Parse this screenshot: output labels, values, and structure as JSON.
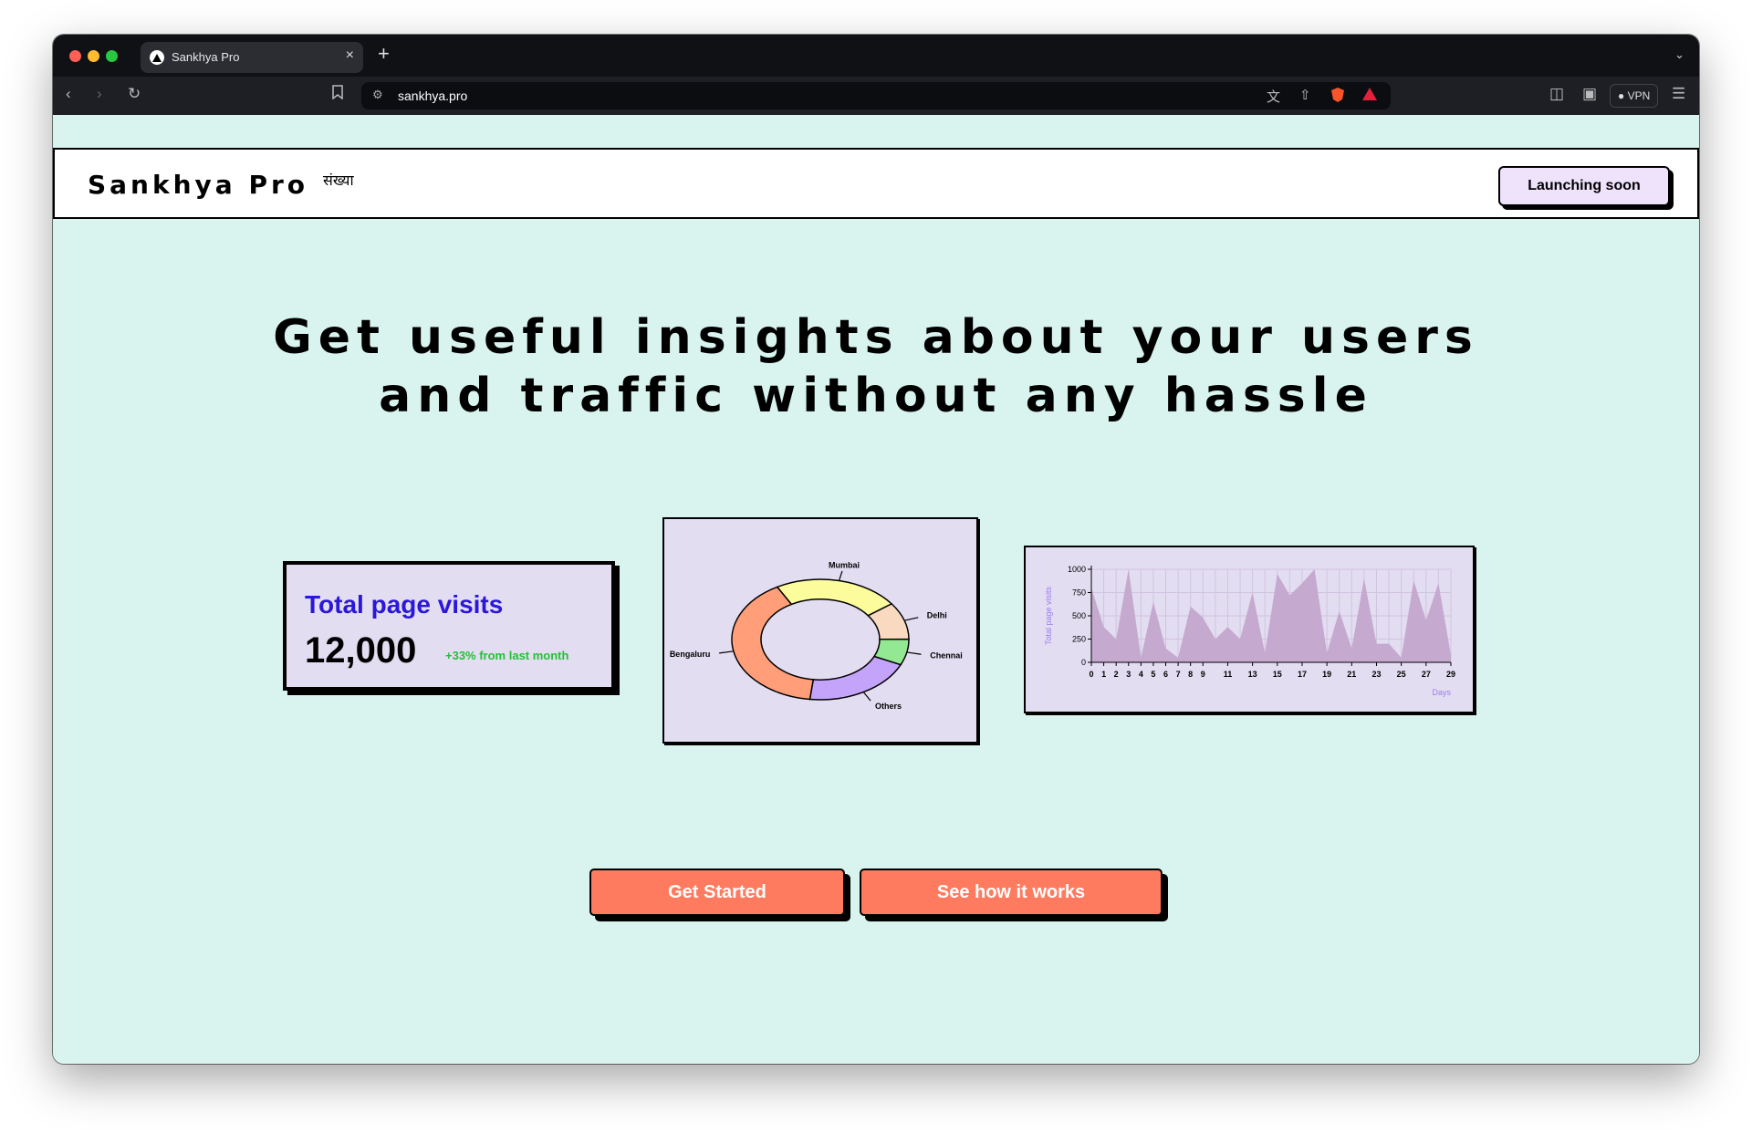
{
  "browser": {
    "tab_title": "Sankhya Pro",
    "url": "sankhya.pro",
    "vpn_label": "VPN",
    "icons": [
      "close-icon",
      "plus-icon",
      "chevron-down-icon",
      "back-icon",
      "forward-icon",
      "reload-icon",
      "bookmark-icon",
      "site-settings-icon",
      "translate-icon",
      "share-icon",
      "brave-shield-icon",
      "brave-rewards-icon",
      "sidebar-icon",
      "wallet-icon",
      "menu-icon"
    ]
  },
  "nav": {
    "brand": "Sankhya Pro",
    "brand_sub": "संख्या",
    "launch_button": "Launching soon"
  },
  "hero": {
    "line1": "Get useful insights about your users",
    "line2": "and traffic without any hassle"
  },
  "stats": {
    "title": "Total page visits",
    "value": "12,000",
    "change": "+33% from last month"
  },
  "buttons": {
    "get_started": "Get Started",
    "how_it_works": "See how it works"
  },
  "chart_data": [
    {
      "type": "pie",
      "donut": true,
      "labels": [
        "Mumbai",
        "Delhi",
        "Chennai",
        "Others",
        "Bengaluru"
      ],
      "values": [
        23,
        10,
        7,
        20,
        40
      ],
      "colors": [
        "#fcfc9d",
        "#f9dac1",
        "#93e893",
        "#c4a4fa",
        "#ff9e78"
      ]
    },
    {
      "type": "area",
      "xlabel": "Days",
      "ylabel": "Total page visits",
      "ylim": [
        0,
        1000
      ],
      "yticks": [
        0,
        250,
        500,
        750,
        1000
      ],
      "xticks": [
        0,
        1,
        2,
        3,
        4,
        5,
        6,
        7,
        8,
        9,
        11,
        13,
        15,
        17,
        19,
        21,
        23,
        25,
        27,
        29
      ],
      "x": [
        0,
        1,
        2,
        3,
        4,
        5,
        6,
        7,
        8,
        9,
        10,
        11,
        12,
        13,
        14,
        15,
        16,
        17,
        18,
        19,
        20,
        21,
        22,
        23,
        24,
        25,
        26,
        27,
        28,
        29
      ],
      "values": [
        800,
        380,
        250,
        1000,
        50,
        650,
        150,
        50,
        600,
        480,
        250,
        380,
        250,
        750,
        100,
        950,
        720,
        850,
        1000,
        100,
        550,
        150,
        900,
        200,
        200,
        50,
        880,
        450,
        850,
        80
      ],
      "color": "#c5a9cf"
    }
  ]
}
